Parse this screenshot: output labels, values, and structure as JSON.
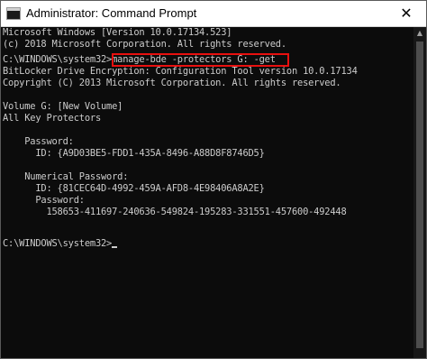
{
  "window": {
    "title": "Administrator: Command Prompt",
    "close_symbol": "✕"
  },
  "console": {
    "lines": [
      "Microsoft Windows [Version 10.0.17134.523]",
      "(c) 2018 Microsoft Corporation. All rights reserved.",
      "",
      "BitLocker Drive Encryption: Configuration Tool version 10.0.17134",
      "Copyright (C) 2013 Microsoft Corporation. All rights reserved.",
      "",
      "Volume G: [New Volume]",
      "All Key Protectors",
      "",
      "    Password:",
      "      ID: {A9D03BE5-FDD1-435A-8496-A88D8F8746D5}",
      "",
      "    Numerical Password:",
      "      ID: {81CEC64D-4992-459A-AFD8-4E98406A8A2E}",
      "      Password:",
      "        158653-411697-240636-549824-195283-331551-457600-492448",
      "",
      "",
      "C:\\WINDOWS\\system32>"
    ],
    "command_prompt": "C:\\WINDOWS\\system32>",
    "command": "manage-bde -protectors G: -get"
  },
  "colors": {
    "background": "#0c0c0c",
    "text": "#cccccc",
    "highlight": "#e8100f"
  },
  "icons": {
    "app": "cmd-icon",
    "close": "close-icon"
  }
}
